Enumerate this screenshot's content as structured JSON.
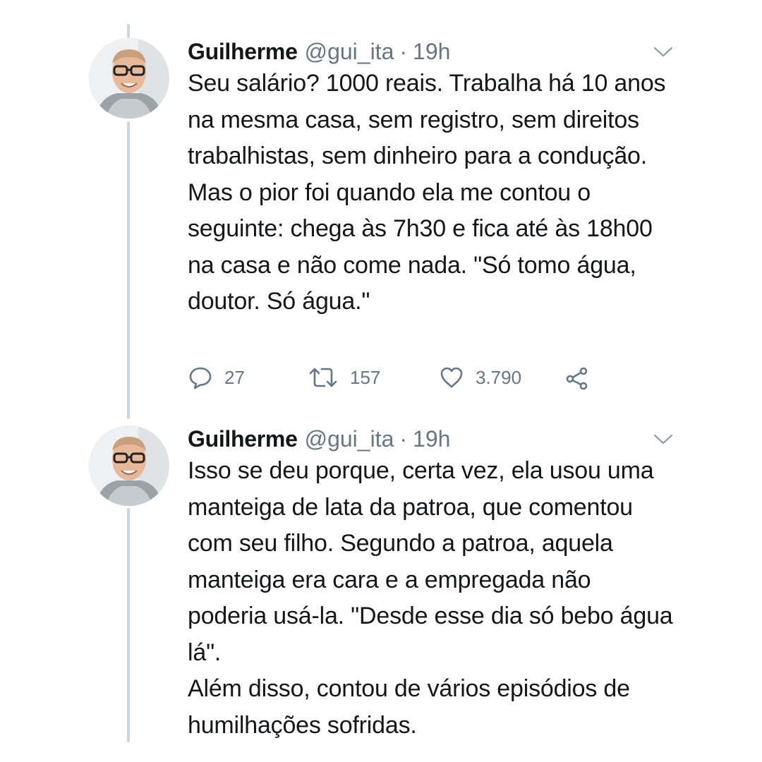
{
  "tweets": [
    {
      "author_name": "Guilherme",
      "author_handle": "@gui_ita",
      "separator": "·",
      "time": "19h",
      "paragraphs": [
        "Seu salário? 1000 reais. Trabalha há 10 anos na mesma casa, sem registro, sem direitos trabalhistas, sem dinheiro para a condução.",
        "Mas o pior foi quando ela me contou o seguinte: chega às 7h30 e fica até às 18h00 na casa e não come nada. \"Só tomo água, doutor. Só água.\""
      ],
      "actions": {
        "replies": "27",
        "retweets": "157",
        "likes": "3.790"
      },
      "icons": [
        "reply-icon",
        "retweet-icon",
        "like-icon",
        "share-icon",
        "chevron-down-icon"
      ]
    },
    {
      "author_name": "Guilherme",
      "author_handle": "@gui_ita",
      "separator": "·",
      "time": "19h",
      "paragraphs": [
        "Isso se deu porque, certa vez, ela usou uma manteiga de lata da patroa, que comentou com seu filho. Segundo a patroa, aquela manteiga era cara e a empregada não poderia usá-la. \"Desde esse dia só bebo água lá\".",
        "Além disso, contou de vários episódios de humilhações sofridas."
      ],
      "icons": [
        "chevron-down-icon"
      ]
    }
  ],
  "colors": {
    "text": "#14171a",
    "secondary": "#657786",
    "thread_line": "#ccd6dd",
    "background": "#ffffff"
  }
}
